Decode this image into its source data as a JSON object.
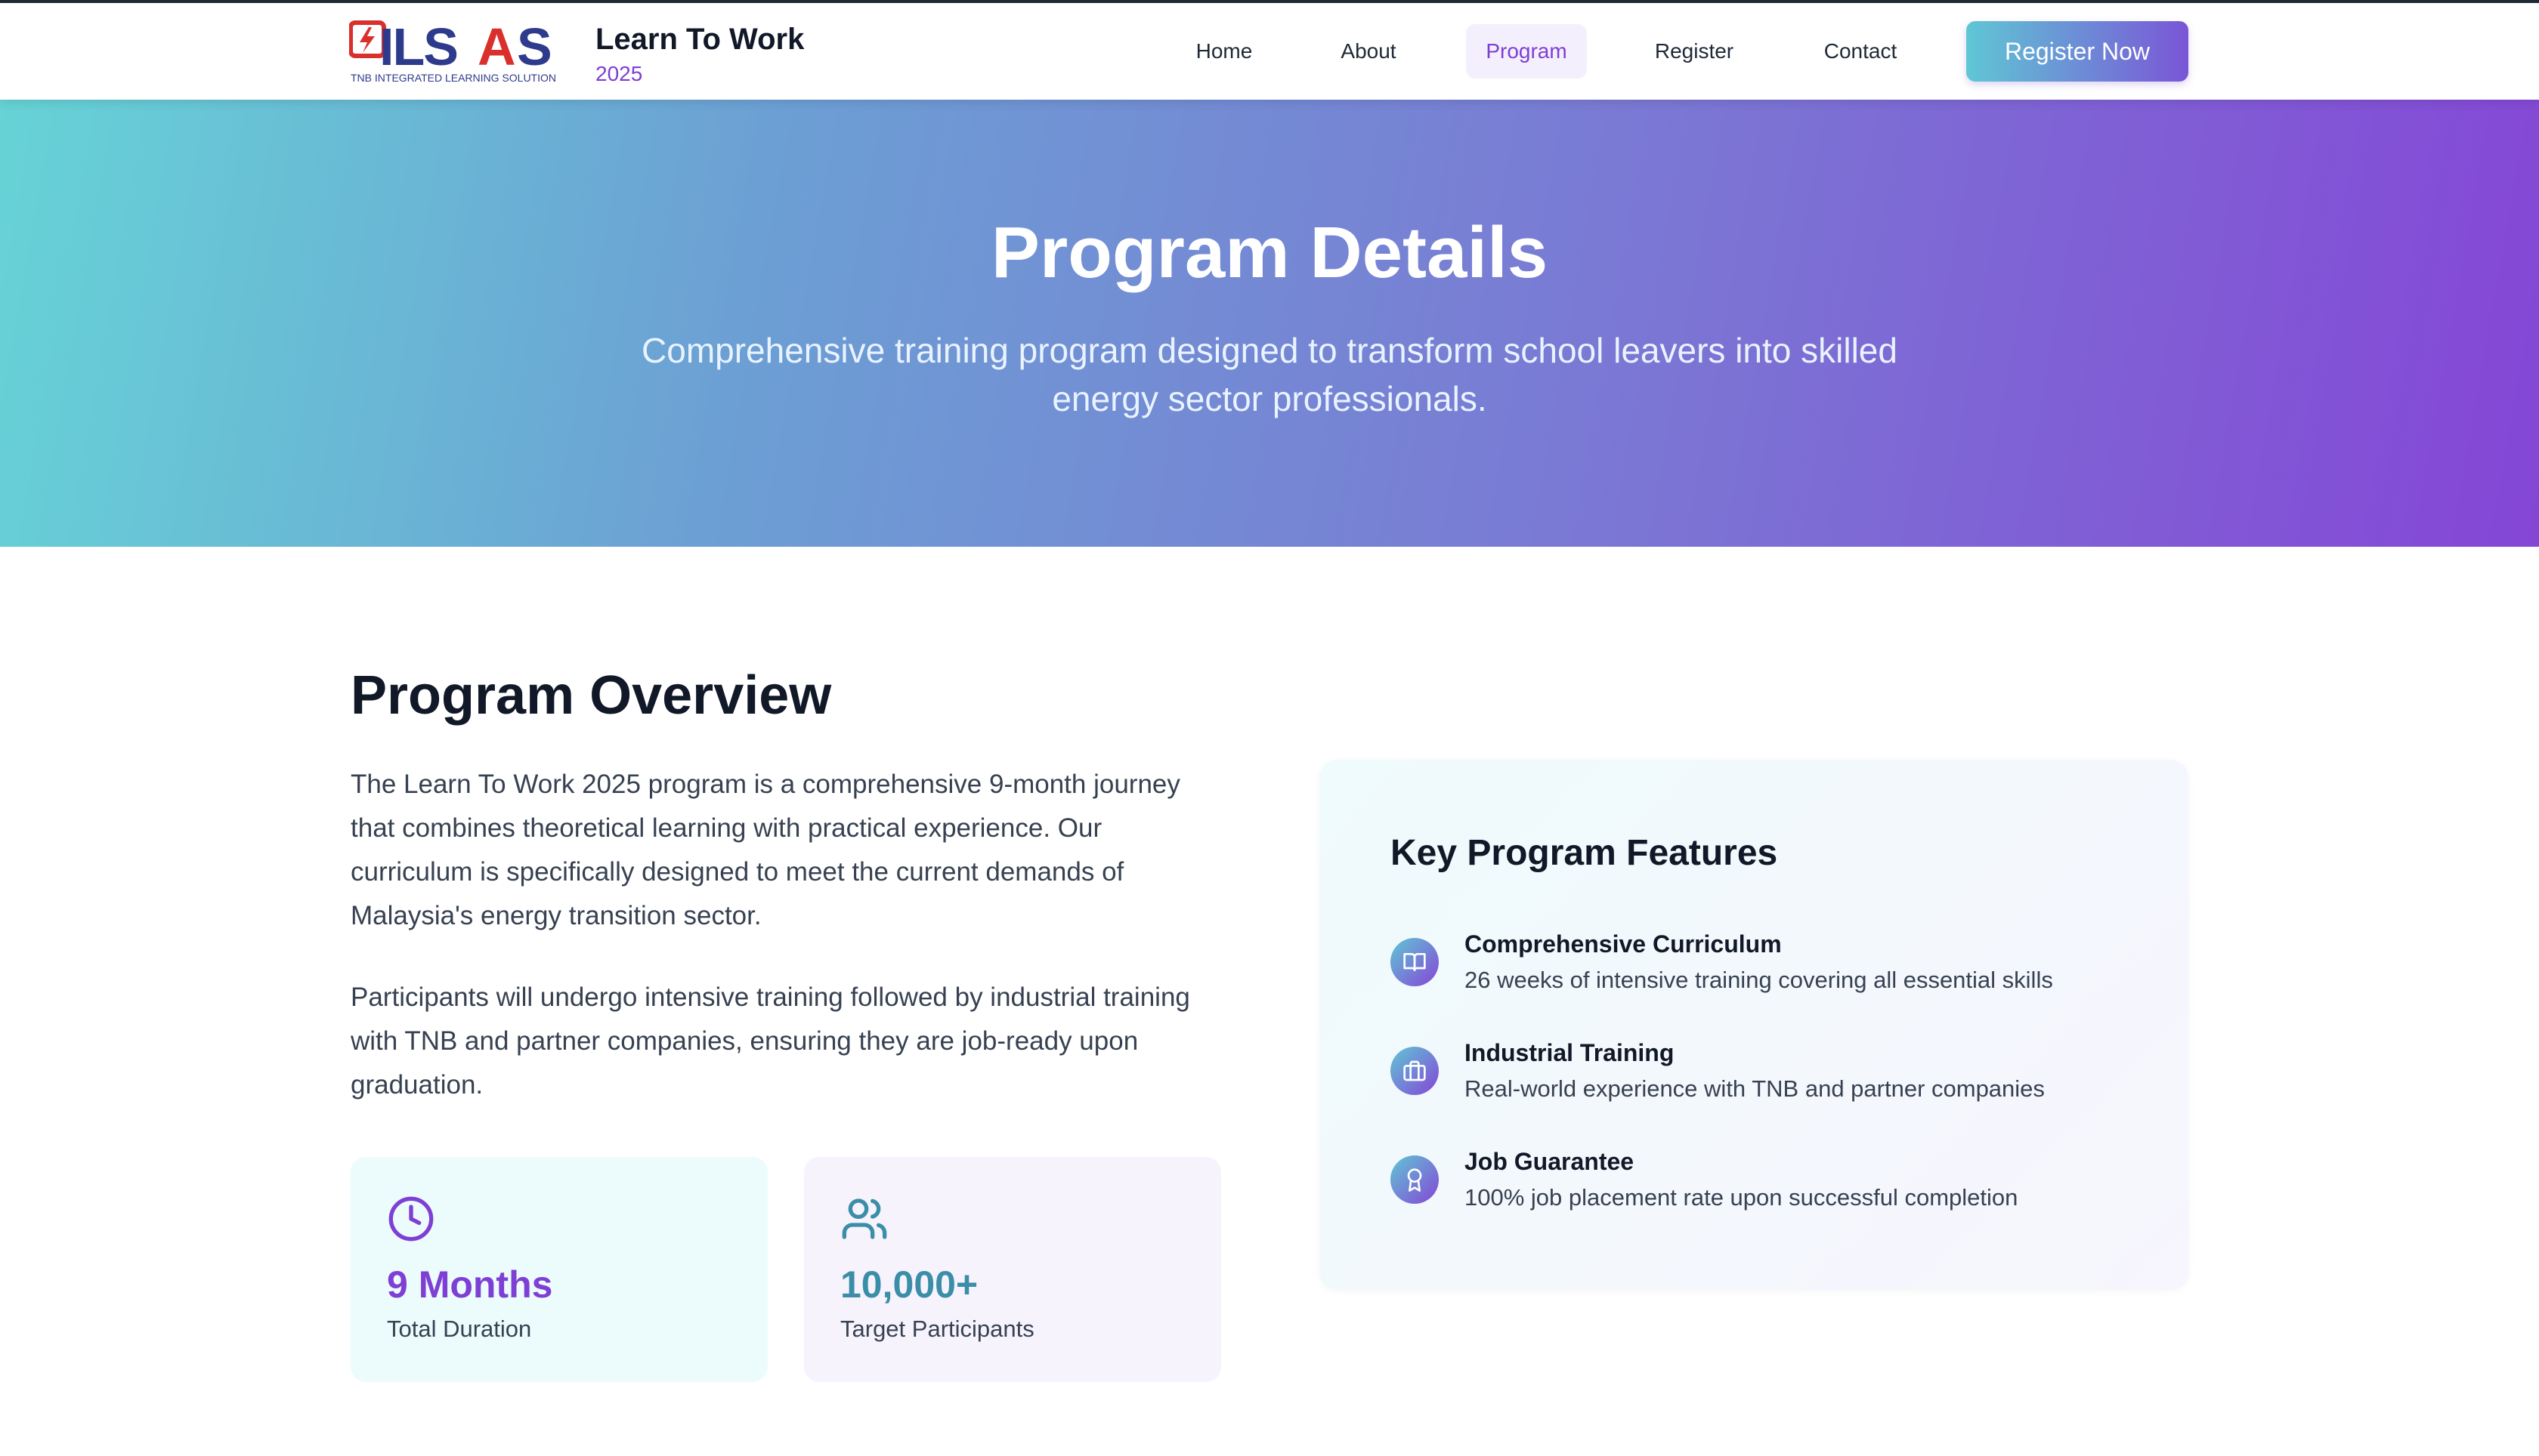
{
  "header": {
    "logo_text": "ILSAS",
    "logo_tagline": "TNB INTEGRATED LEARNING SOLUTION",
    "brand_title": "Learn To Work",
    "brand_year": "2025",
    "nav": [
      {
        "label": "Home"
      },
      {
        "label": "About"
      },
      {
        "label": "Program",
        "active": true
      },
      {
        "label": "Register"
      },
      {
        "label": "Contact"
      }
    ],
    "cta_label": "Register Now"
  },
  "hero": {
    "title": "Program Details",
    "subtitle": "Comprehensive training program designed to transform school leavers into skilled energy sector professionals."
  },
  "overview": {
    "title": "Program Overview",
    "paragraphs": [
      "The Learn To Work 2025 program is a comprehensive 9-month journey that combines theoretical learning with practical experience. Our curriculum is specifically designed to meet the current demands of Malaysia's energy transition sector.",
      "Participants will undergo intensive training followed by industrial training with TNB and partner companies, ensuring they are job-ready upon graduation."
    ],
    "stats": [
      {
        "icon": "clock-icon",
        "value": "9 Months",
        "label": "Total Duration"
      },
      {
        "icon": "users-icon",
        "value": "10,000+",
        "label": "Target Participants"
      }
    ]
  },
  "features": {
    "title": "Key Program Features",
    "items": [
      {
        "icon": "book-icon",
        "title": "Comprehensive Curriculum",
        "desc": "26 weeks of intensive training covering all essential skills"
      },
      {
        "icon": "briefcase-icon",
        "title": "Industrial Training",
        "desc": "Real-world experience with TNB and partner companies"
      },
      {
        "icon": "award-icon",
        "title": "Job Guarantee",
        "desc": "100% job placement rate upon successful completion"
      }
    ]
  },
  "colors": {
    "accent_purple": "#7e3fd4",
    "accent_teal": "#3b8ea8",
    "hero_gradient_start": "#66d3d6",
    "hero_gradient_end": "#8546d6"
  }
}
